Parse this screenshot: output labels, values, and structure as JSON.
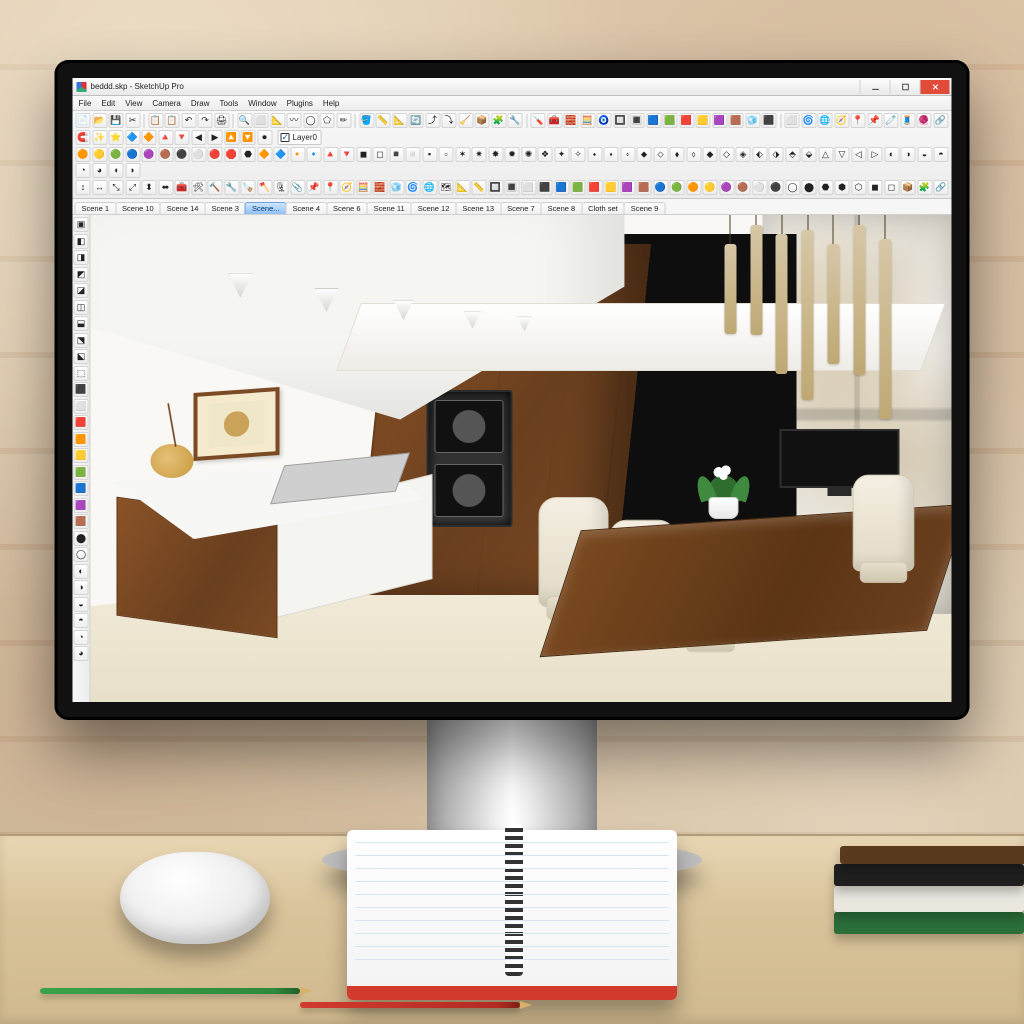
{
  "window": {
    "app_icon": "sketchup-icon",
    "title": "beddd.skp - SketchUp Pro"
  },
  "menu": [
    "File",
    "Edit",
    "View",
    "Camera",
    "Draw",
    "Tools",
    "Window",
    "Plugins",
    "Help"
  ],
  "layer": {
    "visible": true,
    "name": "Layer0"
  },
  "scene_tabs": [
    {
      "label": "Scene 1",
      "active": false
    },
    {
      "label": "Scene 10",
      "active": false
    },
    {
      "label": "Scene 14",
      "active": false
    },
    {
      "label": "Scene 3",
      "active": false
    },
    {
      "label": "Scene...",
      "active": true
    },
    {
      "label": "Scene 4",
      "active": false
    },
    {
      "label": "Scene 6",
      "active": false
    },
    {
      "label": "Scene 11",
      "active": false
    },
    {
      "label": "Scene 12",
      "active": false
    },
    {
      "label": "Scene 13",
      "active": false
    },
    {
      "label": "Scene 7",
      "active": false
    },
    {
      "label": "Scene 8",
      "active": false
    },
    {
      "label": "Cloth set",
      "active": false
    },
    {
      "label": "Scene 9",
      "active": false
    }
  ],
  "top_toolbar_rows": [
    [
      "📄",
      "📂",
      "💾",
      "✂",
      "📋",
      "📋",
      "↶",
      "↷",
      "🖨",
      "🔍",
      "⬜",
      "📐",
      "〰",
      "◯",
      "⬠",
      "✏",
      "🪣",
      "📏",
      "📐",
      "🔄",
      "⤴",
      "⤵",
      "🧹",
      "📦",
      "🧩",
      "🔧",
      "🪛",
      "🧰",
      "🧱",
      "🧮",
      "🧿",
      "🔲",
      "🔳",
      "🟦",
      "🟩",
      "🟥",
      "🟨",
      "🟪",
      "🟫",
      "🧊",
      "⬛",
      "⬜",
      "🌀",
      "🌐",
      "🧭",
      "📍",
      "📌",
      "🧷",
      "🧵",
      "🧶",
      "🔗",
      "🧲",
      "✨",
      "⭐",
      "🔷",
      "🔶",
      "🔺",
      "🔻",
      "◀",
      "▶",
      "🔼",
      "🔽",
      "⏺"
    ],
    [
      "🟠",
      "🟡",
      "🟢",
      "🔵",
      "🟣",
      "🟤",
      "⚫",
      "⚪",
      "🔴",
      "🛑",
      "⬣",
      "🔶",
      "🔷",
      "🔸",
      "🔹",
      "🔺",
      "🔻",
      "◼",
      "◻",
      "◾",
      "◽",
      "▪",
      "▫",
      "✶",
      "✷",
      "✸",
      "✹",
      "✺",
      "❖",
      "✦",
      "✧",
      "⬩",
      "⬪",
      "⬫",
      "⬥",
      "⬦",
      "⬧",
      "⬨",
      "◆",
      "◇",
      "◈",
      "⬖",
      "⬗",
      "⬘",
      "⬙",
      "△",
      "▽",
      "◁",
      "▷",
      "◐",
      "◑",
      "◒",
      "◓",
      "◔",
      "◕",
      "◖",
      "◗"
    ],
    [
      "↕",
      "↔",
      "⤡",
      "⤢",
      "⬍",
      "⬌",
      "🧰",
      "🛠",
      "🔨",
      "🔧",
      "🪚",
      "🪓",
      "🗜",
      "📎",
      "📌",
      "📍",
      "🧭",
      "🧮",
      "🧱",
      "🧊",
      "🌀",
      "🌐",
      "🗺",
      "📐",
      "📏",
      "🔲",
      "🔳",
      "⬜",
      "⬛",
      "🟦",
      "🟩",
      "🟥",
      "🟨",
      "🟪",
      "🟫",
      "🔵",
      "🟢",
      "🟠",
      "🟡",
      "🟣",
      "🟤",
      "⚪",
      "⚫",
      "◯",
      "⬤",
      "⬣",
      "⬢",
      "⬡",
      "◼",
      "◻",
      "📦",
      "🧩",
      "🔗"
    ]
  ],
  "side_toolbar": [
    "▣",
    "◧",
    "◨",
    "◩",
    "◪",
    "◫",
    "⬓",
    "⬔",
    "⬕",
    "⬚",
    "⬛",
    "⬜",
    "🟥",
    "🟧",
    "🟨",
    "🟩",
    "🟦",
    "🟪",
    "🟫",
    "⬤",
    "◯",
    "◐",
    "◑",
    "◒",
    "◓",
    "◔",
    "◕"
  ]
}
